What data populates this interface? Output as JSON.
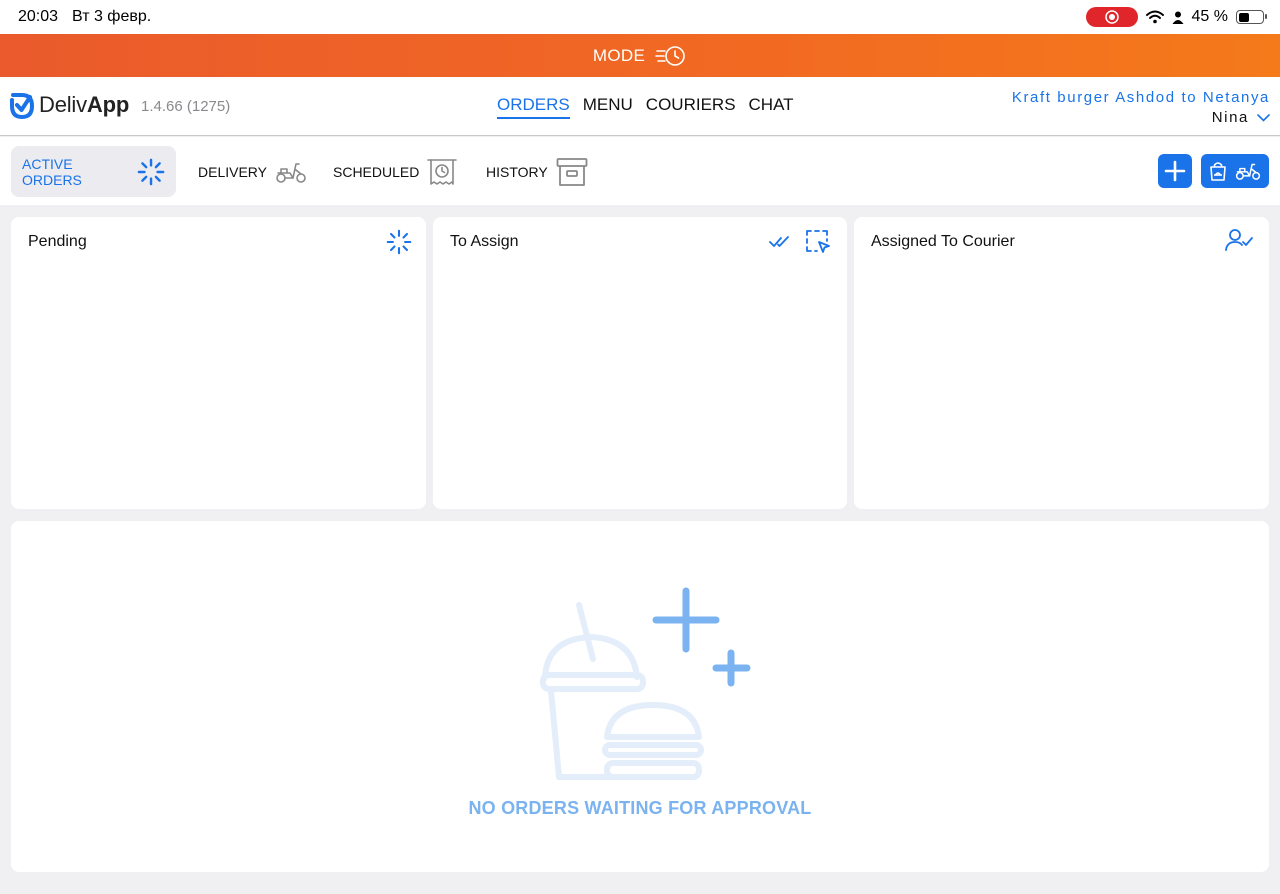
{
  "status_bar": {
    "time": "20:03",
    "date": "Вт 3 февр.",
    "battery": "45 %",
    "battery_level": 0.45
  },
  "mode_banner": {
    "label": "MODE",
    "icon": "fast-clock-icon"
  },
  "header": {
    "logo_plain": "Deliv",
    "logo_bold": "App",
    "version": "1.4.66 (1275)",
    "nav": [
      {
        "label": "ORDERS",
        "active": true
      },
      {
        "label": "MENU",
        "active": false
      },
      {
        "label": "COURIERS",
        "active": false
      },
      {
        "label": "CHAT",
        "active": false
      }
    ],
    "store_name": "Kraft burger Ashdod to Netanya",
    "user_name": "Nina"
  },
  "tabs": [
    {
      "label": "ACTIVE ORDERS",
      "icon": "spinner-icon",
      "active": true
    },
    {
      "label": "DELIVERY",
      "icon": "scooter-icon",
      "active": false
    },
    {
      "label": "SCHEDULED",
      "icon": "scheduled-receipt-icon",
      "active": false
    },
    {
      "label": "HISTORY",
      "icon": "archive-box-icon",
      "active": false
    }
  ],
  "actions": {
    "add_icon": "plus-icon",
    "takeaway_icon": "bag-icon",
    "delivery_icon": "scooter-icon"
  },
  "panels": {
    "pending": {
      "title": "Pending",
      "icon": "spinner-icon"
    },
    "to_assign": {
      "title": "To Assign",
      "icons": [
        "double-check-icon",
        "select-cursor-icon"
      ]
    },
    "assigned": {
      "title": "Assigned To Courier",
      "icon": "user-check-icon"
    }
  },
  "empty_state": {
    "message": "NO ORDERS WAITING FOR APPROVAL",
    "illustration": "drink-burger-plus-illustration"
  },
  "colors": {
    "accent": "#1a73e8",
    "banner": "#f26a22",
    "empty_text": "#7ab3ef",
    "record": "#e0262a"
  }
}
